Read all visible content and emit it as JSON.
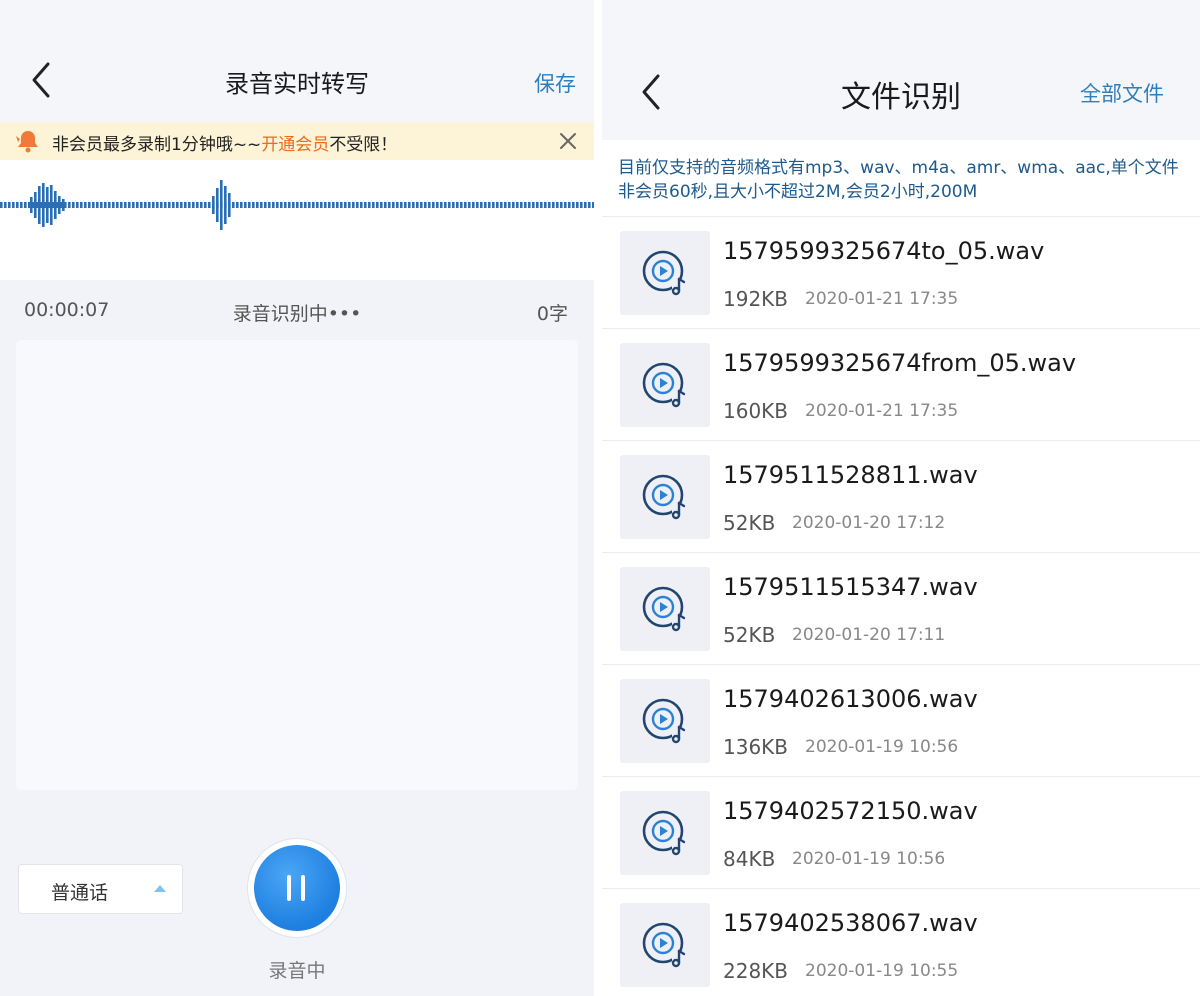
{
  "left_screen": {
    "title": "录音实时转写",
    "save_label": "保存",
    "banner": {
      "text_prefix": "非会员最多录制1分钟哦~~",
      "vip_link": "开通会员",
      "text_suffix": "不受限！"
    },
    "status": {
      "elapsed": "00:00:07",
      "state": "录音识别中•••",
      "word_count": "0字"
    },
    "language_select": {
      "value": "普通话"
    },
    "record_state_label": "录音中"
  },
  "right_screen": {
    "title": "文件识别",
    "all_files_label": "全部文件",
    "notice": "目前仅支持的音频格式有mp3、wav、m4a、amr、wma、aac,单个文件非会员60秒,且大小不超过2M,会员2小时,200M",
    "files": [
      {
        "name": "1579599325674to_05.wav",
        "size": "192KB",
        "date": "2020-01-21 17:35"
      },
      {
        "name": "1579599325674from_05.wav",
        "size": "160KB",
        "date": "2020-01-21 17:35"
      },
      {
        "name": "1579511528811.wav",
        "size": "52KB",
        "date": "2020-01-20 17:12"
      },
      {
        "name": "1579511515347.wav",
        "size": "52KB",
        "date": "2020-01-20 17:11"
      },
      {
        "name": "1579402613006.wav",
        "size": "136KB",
        "date": "2020-01-19 10:56"
      },
      {
        "name": "1579402572150.wav",
        "size": "84KB",
        "date": "2020-01-19 10:56"
      },
      {
        "name": "1579402538067.wav",
        "size": "228KB",
        "date": "2020-01-19 10:55"
      }
    ]
  },
  "colors": {
    "accent_blue": "#2d7fc0",
    "record_button": "#1e7fe0",
    "vip_orange": "#ef6a1b",
    "banner_bg": "#fdf3d6",
    "waveform": "#2a6eb4"
  },
  "icons": {
    "back": "chevron-left-icon",
    "close": "close-icon",
    "bell": "bell-icon",
    "pause": "pause-icon",
    "audio_file": "audio-file-icon",
    "caret": "caret-up-icon"
  }
}
